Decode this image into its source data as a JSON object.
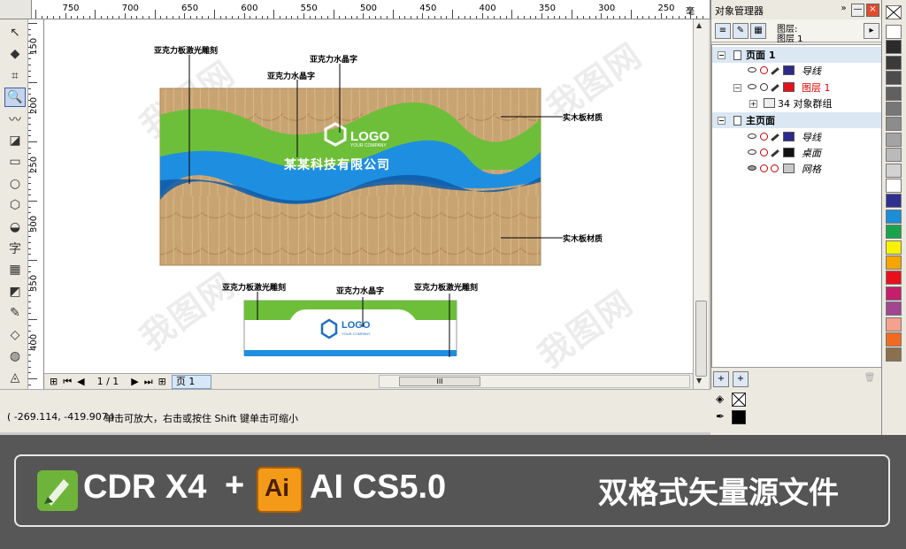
{
  "ruler": {
    "h_labels": [
      "750",
      "700",
      "650",
      "600",
      "550",
      "500",
      "450",
      "400",
      "350",
      "300",
      "250",
      "毫米"
    ],
    "v_labels": [
      "150",
      "200",
      "250",
      "300",
      "350",
      "400"
    ]
  },
  "toolbox": {
    "tools": [
      "pick-tool",
      "shape-tool",
      "crop-tool",
      "zoom-tool",
      "freehand-tool",
      "smart-fill-tool",
      "rectangle-tool",
      "ellipse-tool",
      "polygon-tool",
      "basic-shapes-tool",
      "text-tool",
      "table-tool",
      "interactive-tool",
      "eyedropper-tool",
      "outline-tool",
      "fill-tool",
      "interactive-fill-tool"
    ],
    "text_tool_glyph": "字"
  },
  "canvas": {
    "callouts": {
      "c1": "亚克力板激光雕刻",
      "c2": "亚克力水晶字",
      "c3": "亚克力水晶字",
      "c4": "实木板材质",
      "c5": "实木板材质",
      "c6": "亚克力板激光雕刻",
      "c7": "亚克力水晶字",
      "c8": "亚克力板激光雕刻"
    },
    "logo_text": "LOGO",
    "company_name": "某某科技有限公司",
    "small_logo_text": "LOGO",
    "small_logo_sub": "YOUR COMPANY",
    "big_logo_sub": "YOUR COMPANY",
    "watermark": "我图网",
    "colors": {
      "wood": "#c8a371",
      "green": "#6dbf3a",
      "blue": "#1e8fe0",
      "darkblue": "#0e5aa8"
    }
  },
  "pagebar": {
    "page_count": "1 / 1",
    "page_tab": "页 1",
    "scroll_thumb": "III"
  },
  "status": {
    "coords": "( -269.114, -419.907 )",
    "hint": "单击可放大，右击或按住 Shift 键单击可缩小"
  },
  "docker": {
    "title": "对象管理器",
    "layer_label_1": "图层:",
    "layer_label_2": "图层 1",
    "tree": {
      "page1": "页面 1",
      "guides1": "导线",
      "layer1": "图层 1",
      "group": "34 对象群组",
      "master": "主页面",
      "guides2": "导线",
      "desktop": "桌面",
      "grid": "网格"
    }
  },
  "palette": [
    "#ffffff",
    "#2b2b2b",
    "#3a3a3a",
    "#4d4d4d",
    "#606060",
    "#777777",
    "#8c8c8c",
    "#a3a3a3",
    "#bababa",
    "#d2d2d2",
    "#ffffff",
    "#2f2f8f",
    "#1a8ed6",
    "#19a44a",
    "#f6f200",
    "#f5a500",
    "#e8101a",
    "#c51e6a",
    "#a1468f",
    "#f4a28e",
    "#f06b21",
    "#8b6f4e"
  ],
  "banner": {
    "cdr_text": "CDR X4",
    "plus": "+",
    "ai_icon_text": "Ai",
    "ai_text": "AI CS5.0",
    "slogan": "双格式矢量源文件"
  }
}
